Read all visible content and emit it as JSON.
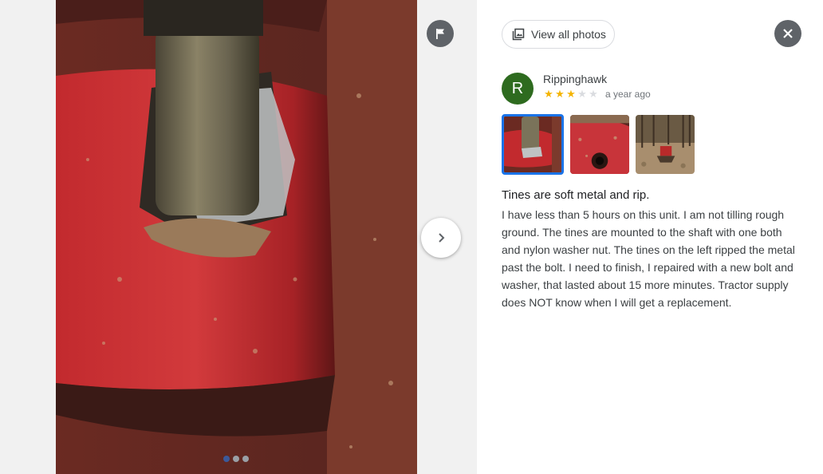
{
  "viewer": {
    "flag_icon": "flag-icon",
    "next_icon": "chevron-right-icon",
    "photo_count": 3,
    "active_photo": 1
  },
  "panel": {
    "view_all_label": "View all photos",
    "view_all_icon": "photo-library-icon",
    "close_icon": "close-icon"
  },
  "review": {
    "avatar_initial": "R",
    "avatar_color": "#2e6b1f",
    "author": "Rippinghawk",
    "rating": 3,
    "rating_max": 5,
    "date": "a year ago",
    "title": "Tines are soft metal and rip.",
    "body": "I have less than 5 hours on this unit. I am not tilling rough ground. The tines are mounted to the shaft with one both and nylon washer nut. The tines on the left ripped the metal past the bolt. I need to finish, I repaired with a new bolt and washer, that lasted about 15 more minutes. Tractor supply does NOT know when I will get a replacement."
  },
  "colors": {
    "star_on": "#f4b400",
    "star_off": "#dadce0",
    "selected_border": "#1a73e8"
  }
}
